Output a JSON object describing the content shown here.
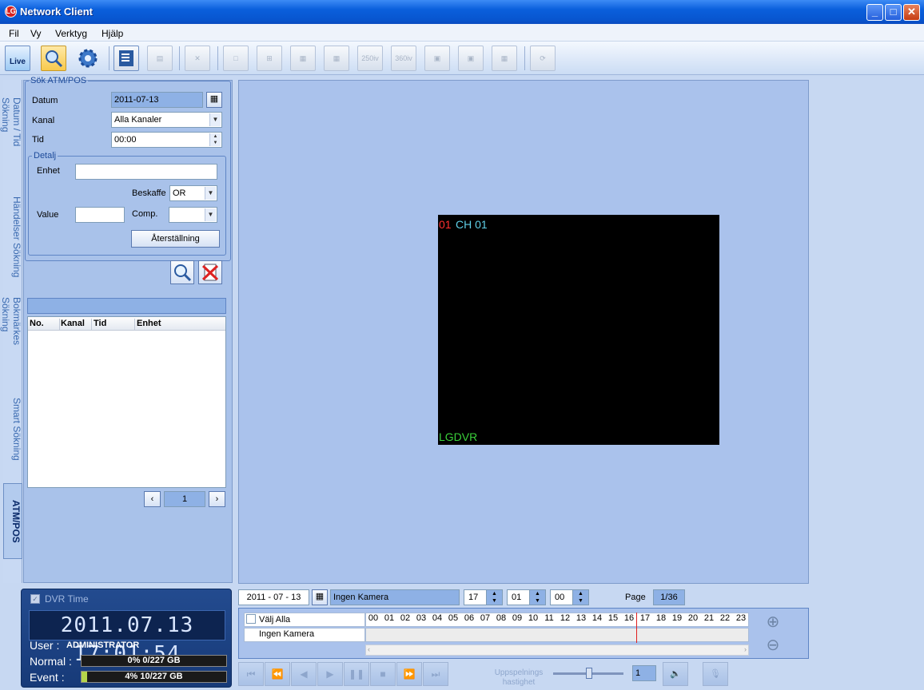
{
  "window": {
    "title": "Network Client"
  },
  "menu": [
    "Fil",
    "Vy",
    "Verktyg",
    "Hjälp"
  ],
  "toolbar": {
    "live": "Live",
    "split_250": "250iv",
    "split_360": "360iv"
  },
  "side_tabs": [
    "Datum / Tid Sökning",
    "Händelser Sökning",
    "Bokmärkes Sökning",
    "Smart Sökning",
    "ATM/POS"
  ],
  "search": {
    "group_title": "Sök ATM/POS",
    "date_label": "Datum",
    "date_value": "2011-07-13",
    "channel_label": "Kanal",
    "channel_value": "Alla Kanaler",
    "time_label": "Tid",
    "time_value": "00:00",
    "detail": {
      "title": "Detalj",
      "unit_label": "Enhet",
      "unit_value": "",
      "type_label": "Beskaffe",
      "type_value": "OR",
      "value_label": "Value",
      "value_value": "",
      "comp_label": "Comp.",
      "comp_value": "",
      "reset_label": "Återställning"
    }
  },
  "results": {
    "columns": [
      "No.",
      "Kanal",
      "Tid",
      "Enhet"
    ],
    "page": "1"
  },
  "video": {
    "channel_num": "01",
    "channel_name": "CH 01",
    "watermark": "LGDVR"
  },
  "dvr": {
    "checkbox_label": "DVR Time",
    "time": "2011.07.13  17:01:54",
    "user_label": "User :",
    "user_value": "ADMINISTRATOR",
    "normal_label": "Normal :",
    "normal_value": "0% 0/227 GB",
    "normal_pct": 0,
    "event_label": "Event  :",
    "event_value": "4% 10/227 GB",
    "event_pct": 4
  },
  "timeline": {
    "date": "2011 - 07 - 13",
    "camera": "Ingen Kamera",
    "hour": "17",
    "minute": "01",
    "second": "00",
    "page_label": "Page",
    "page_value": "1/36",
    "select_all": "Välj Alla",
    "camera_row": "Ingen Kamera",
    "hours": [
      "00",
      "01",
      "02",
      "03",
      "04",
      "05",
      "06",
      "07",
      "08",
      "09",
      "10",
      "11",
      "12",
      "13",
      "14",
      "15",
      "16",
      "17",
      "18",
      "19",
      "20",
      "21",
      "22",
      "23"
    ],
    "cursor_hour": 17.02
  },
  "playback": {
    "speed_label": "Uppspelnings hastighet",
    "speed_value": "1"
  }
}
